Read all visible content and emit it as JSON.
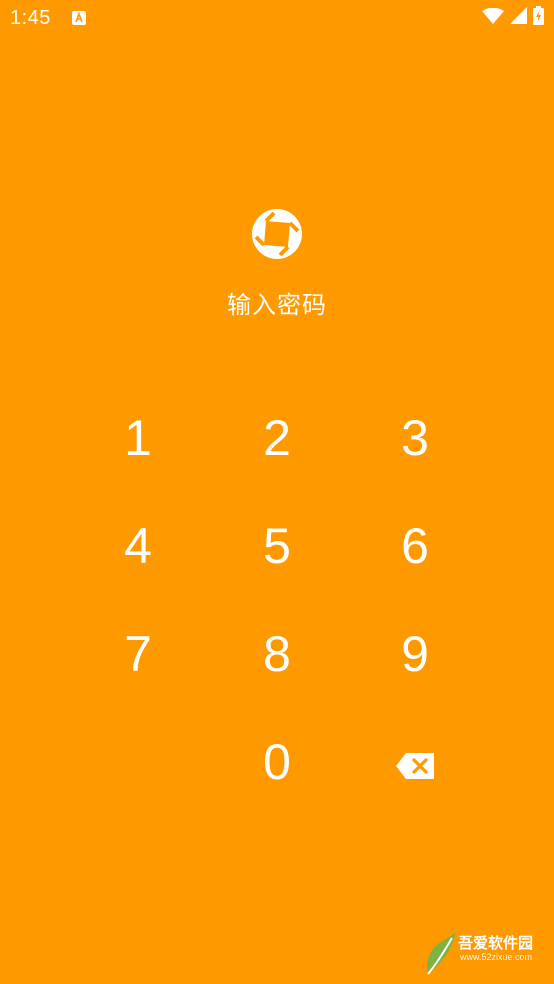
{
  "status_bar": {
    "time": "1:45",
    "notification_icon": "a-letter-box-icon",
    "icons": [
      "wifi-icon",
      "cell-signal-icon",
      "battery-charging-icon"
    ]
  },
  "lock_screen": {
    "logo_icon": "app-logo-icon",
    "prompt": "输入密码",
    "background_color": "#FF9900",
    "foreground_color": "#FFFFFF"
  },
  "keypad": {
    "keys": [
      "1",
      "2",
      "3",
      "4",
      "5",
      "6",
      "7",
      "8",
      "9",
      "0"
    ],
    "backspace_icon": "backspace-icon"
  },
  "watermark": {
    "site_name": "吾爱软件园",
    "url": "www.52zixue.com"
  }
}
